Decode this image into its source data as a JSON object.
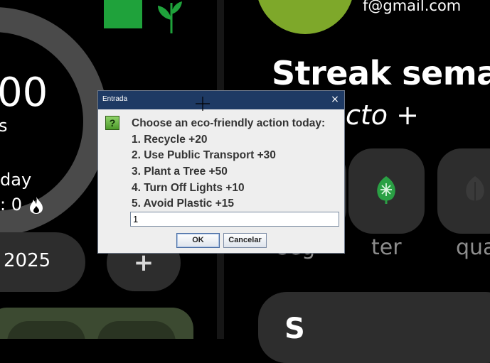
{
  "left_panel": {
    "big_number": "00",
    "big_unit": "s",
    "day_label": "day",
    "day_value": ": 0",
    "date_text": "2025",
    "add_label": "+"
  },
  "right_panel": {
    "email": "f@gmail.com",
    "streak_title": "Streak sema",
    "subtitle": "cto +",
    "day_labels": [
      "seg",
      "ter",
      "qua"
    ],
    "bottom_letter": "S"
  },
  "dialog": {
    "title": "Entrada",
    "close_label": "×",
    "icon": "?",
    "message_lines": [
      "Choose an eco-friendly action today:",
      "1. Recycle +20",
      "2. Use Public Transport +30",
      "3. Plant a Tree +50",
      "4. Turn Off Lights +10",
      "5. Avoid Plastic +15"
    ],
    "input_value": "1",
    "ok_label": "OK",
    "cancel_label": "Cancelar"
  },
  "colors": {
    "background": "#000000",
    "card": "#2d2d2d",
    "accent_green": "#7ea82a",
    "titlebar": "#1e3a64"
  }
}
